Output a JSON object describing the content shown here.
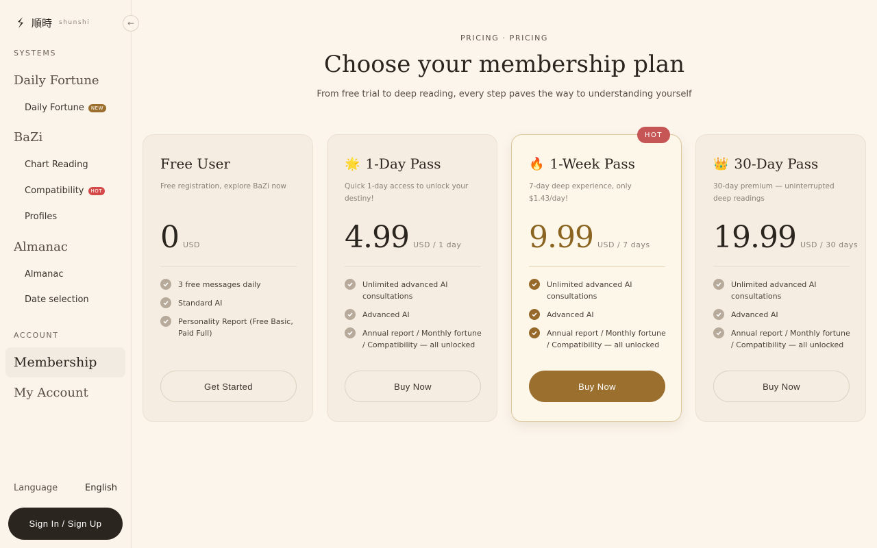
{
  "brand": {
    "name": "順時",
    "sub": "shunshi"
  },
  "sidebar": {
    "systems_label": "SYSTEMS",
    "daily_fortune_group": "Daily Fortune",
    "daily_fortune_item": "Daily Fortune",
    "daily_fortune_badge": "NEW",
    "bazi_group": "BaZi",
    "chart_reading": "Chart Reading",
    "compatibility": "Compatibility",
    "compatibility_badge": "HOT",
    "profiles": "Profiles",
    "almanac_group": "Almanac",
    "almanac_item": "Almanac",
    "date_selection": "Date selection",
    "account_label": "ACCOUNT",
    "membership": "Membership",
    "my_account": "My Account",
    "language_label": "Language",
    "language_value": "English",
    "signin": "Sign In / Sign Up"
  },
  "header": {
    "eyebrow": "PRICING · PRICING",
    "title": "Choose your membership plan",
    "subtitle": "From free trial to deep reading, every step paves the way to understanding yourself"
  },
  "plans": [
    {
      "emoji": "",
      "name": "Free User",
      "desc": "Free registration, explore BaZi now",
      "price": "0",
      "unit": "USD",
      "features": [
        "3 free messages daily",
        "Standard AI",
        "Personality Report (Free Basic, Paid Full)"
      ],
      "cta": "Get Started"
    },
    {
      "emoji": "🌟",
      "name": "1-Day Pass",
      "desc": "Quick 1-day access to unlock your destiny!",
      "price": "4.99",
      "unit": "USD / 1 day",
      "features": [
        "Unlimited advanced AI consultations",
        "Advanced AI",
        "Annual report / Monthly fortune / Compatibility — all unlocked"
      ],
      "cta": "Buy Now"
    },
    {
      "emoji": "🔥",
      "name": "1-Week Pass",
      "desc": "7-day deep experience, only $1.43/day!",
      "price": "9.99",
      "unit": "USD / 7 days",
      "badge": "HOT",
      "features": [
        "Unlimited advanced AI consultations",
        "Advanced AI",
        "Annual report / Monthly fortune / Compatibility — all unlocked"
      ],
      "cta": "Buy Now"
    },
    {
      "emoji": "👑",
      "name": "30-Day Pass",
      "desc": "30-day premium — uninterrupted deep readings",
      "price": "19.99",
      "unit": "USD / 30 days",
      "features": [
        "Unlimited advanced AI consultations",
        "Advanced AI",
        "Annual report / Monthly fortune / Compatibility — all unlocked"
      ],
      "cta": "Buy Now"
    }
  ],
  "colors": {
    "accent": "#9b6f2e",
    "hot": "#c65656",
    "background": "#fbf5ec",
    "dark": "#2b2520"
  }
}
